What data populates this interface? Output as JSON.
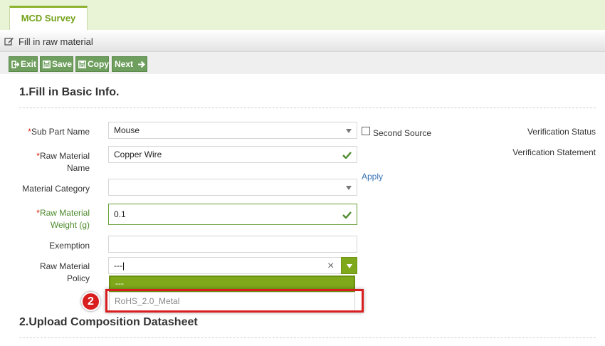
{
  "tabs": [
    {
      "label": "MCD Survey"
    }
  ],
  "page": {
    "title": "Fill in raw material"
  },
  "toolbar": {
    "exit": "Exit",
    "save": "Save",
    "copy": "Copy",
    "next": "Next"
  },
  "sections": {
    "basic": "1.Fill in Basic Info.",
    "upload": "2.Upload Composition Datasheet"
  },
  "form": {
    "sub_part_name": {
      "label": "Sub Part Name",
      "required": "*",
      "value": "Mouse"
    },
    "second_source": {
      "label": "Second Source",
      "checked": false
    },
    "raw_material_name": {
      "label_line1": "Raw Material",
      "label_line2": "Name",
      "required": "*",
      "value": "Copper Wire"
    },
    "apply_link": "Apply",
    "material_category": {
      "label": "Material Category",
      "value": ""
    },
    "raw_material_weight": {
      "label_line1": "Raw Material",
      "label_line2": "Weight (g)",
      "required": "*",
      "value": "0.1"
    },
    "exemption": {
      "label": "Exemption",
      "value": ""
    },
    "raw_material_policy": {
      "label_line1": "Raw Material",
      "label_line2": "Policy",
      "value": "---",
      "clear": "×",
      "options": [
        {
          "label": "---",
          "selected": true
        },
        {
          "label": "RoHS_2.0_Metal",
          "selected": false
        }
      ]
    },
    "verification_status": {
      "label": "Verification Status"
    },
    "verification_statement": {
      "label": "Verification Statement"
    }
  },
  "annotation": {
    "step": "2",
    "color": "#d81e1e"
  },
  "colors": {
    "accent": "#7fa81a",
    "button": "#6e9f5e",
    "required": "#d81e06",
    "link": "#3a73b5"
  }
}
